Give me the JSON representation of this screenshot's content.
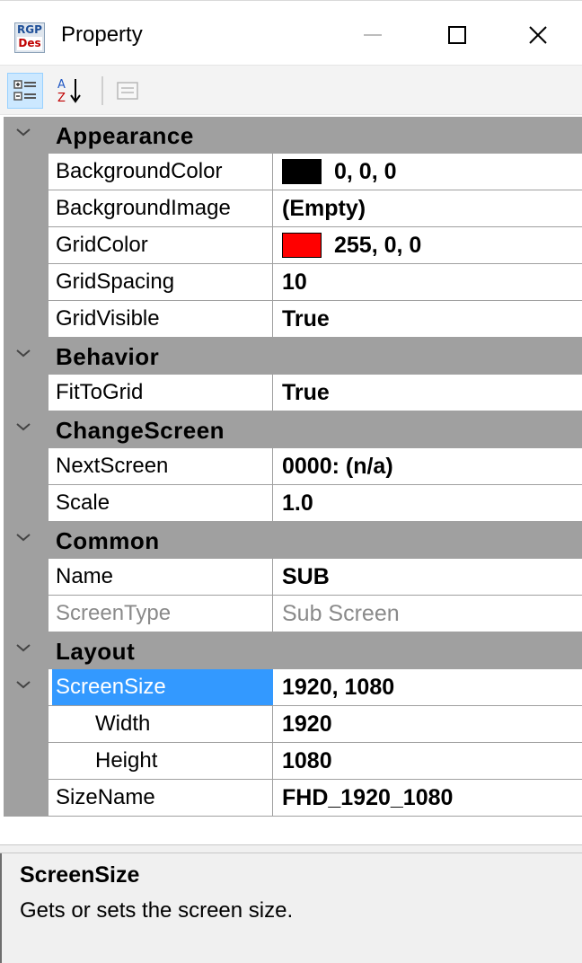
{
  "window": {
    "title": "Property",
    "icon_label_top": "RGP",
    "icon_label_bottom": "Des"
  },
  "toolbar": {
    "buttons": [
      {
        "icon": "categorized-icon",
        "active": true
      },
      {
        "icon": "alphabetical-sort-icon",
        "active": false
      },
      {
        "icon": "property-pages-icon",
        "active": false,
        "enabled": false
      }
    ]
  },
  "categories": {
    "appearance": "Appearance",
    "behavior": "Behavior",
    "change_screen": "ChangeScreen",
    "common": "Common",
    "layout": "Layout"
  },
  "properties": {
    "background_color": {
      "name": "BackgroundColor",
      "value": "0, 0, 0",
      "swatch": "#000000"
    },
    "background_image": {
      "name": "BackgroundImage",
      "value": "(Empty)"
    },
    "grid_color": {
      "name": "GridColor",
      "value": "255, 0, 0",
      "swatch": "#ff0000"
    },
    "grid_spacing": {
      "name": "GridSpacing",
      "value": "10"
    },
    "grid_visible": {
      "name": "GridVisible",
      "value": "True"
    },
    "fit_to_grid": {
      "name": "FitToGrid",
      "value": "True"
    },
    "next_screen": {
      "name": "NextScreen",
      "value": "0000: (n/a)"
    },
    "scale": {
      "name": "Scale",
      "value": "1.0"
    },
    "name": {
      "name": "Name",
      "value": "SUB"
    },
    "screen_type": {
      "name": "ScreenType",
      "value": "Sub Screen",
      "readonly": true
    },
    "screen_size": {
      "name": "ScreenSize",
      "value": "1920, 1080",
      "selected": true,
      "expanded": true
    },
    "width": {
      "name": "Width",
      "value": "1920"
    },
    "height": {
      "name": "Height",
      "value": "1080"
    },
    "size_name": {
      "name": "SizeName",
      "value": "FHD_1920_1080"
    }
  },
  "description": {
    "title": "ScreenSize",
    "text": "Gets or sets the screen size."
  },
  "colors": {
    "selection": "#3399ff",
    "category_bar": "#a0a0a0",
    "toolbar_active": "#cce8ff"
  }
}
